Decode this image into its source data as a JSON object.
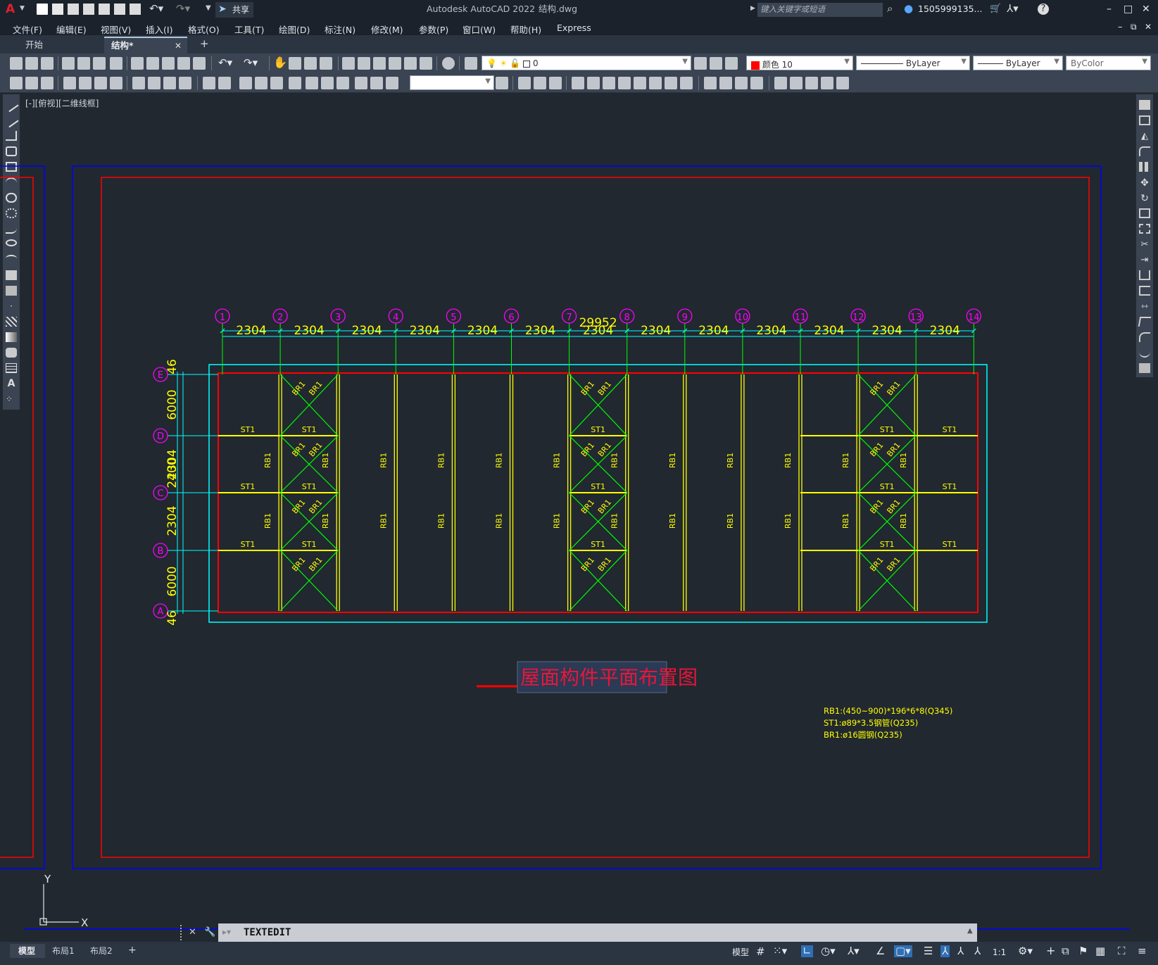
{
  "app": {
    "title": "Autodesk AutoCAD 2022",
    "filename": "结构.dwg",
    "share_label": "共享",
    "search_placeholder": "键入关键字或短语",
    "user": "1505999135...",
    "logo": "A"
  },
  "menu": [
    "文件(F)",
    "编辑(E)",
    "视图(V)",
    "插入(I)",
    "格式(O)",
    "工具(T)",
    "绘图(D)",
    "标注(N)",
    "修改(M)",
    "参数(P)",
    "窗口(W)",
    "帮助(H)",
    "Express"
  ],
  "tabs": [
    {
      "label": "开始",
      "active": false
    },
    {
      "label": "结构*",
      "active": true
    }
  ],
  "layer_combo": "0",
  "color_combo": "颜色 10",
  "linetype_combo": "ByLayer",
  "lineweight_combo": "ByLayer",
  "plotstyle_combo": "ByColor",
  "viewport_label": "[-][俯视][二维线框]",
  "drawing": {
    "grid_numbers": [
      "1",
      "2",
      "3",
      "4",
      "5",
      "6",
      "7",
      "8",
      "9",
      "10",
      "11",
      "12",
      "13",
      "14"
    ],
    "span": "2304",
    "total": "29952",
    "row_letters": [
      "E",
      "D",
      "C",
      "B",
      "A"
    ],
    "left_dims": [
      "46",
      "6000",
      "2304",
      "2400",
      "2304",
      "6000",
      "46"
    ],
    "st_label": "ST1",
    "br_label": "BR1",
    "rb_label": "RB1",
    "title": "屋面构件平面布置图",
    "notes": [
      "RB1:(450~900)*196*6*8(Q345)",
      "ST1:ø89*3.5钢管(Q235)",
      "BR1:ø16圆钢(Q235)"
    ],
    "ucs_x": "X",
    "ucs_y": "Y"
  },
  "command": "TEXTEDIT",
  "layout_tabs": [
    "模型",
    "布局1",
    "布局2"
  ],
  "status": {
    "model": "模型",
    "scale": "1:1"
  },
  "colors": {
    "drawing_bg": "#212830",
    "yellow": "#ffff00",
    "green": "#00ff00",
    "red": "#ff0000",
    "cyan": "#00ffff",
    "magenta": "#ff00ff",
    "blue": "#0000ff"
  }
}
